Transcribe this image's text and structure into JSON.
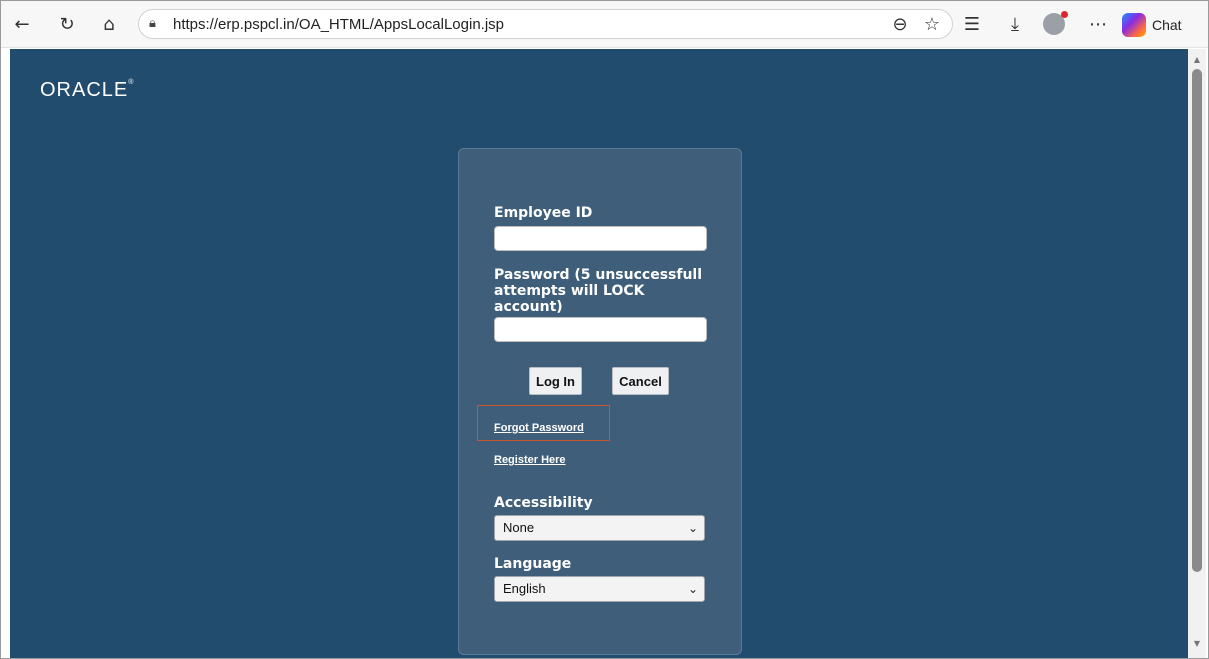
{
  "browser": {
    "url": "https://erp.pspcl.in/OA_HTML/AppsLocalLogin.jsp",
    "chat_label": "Chat",
    "icons": [
      "back-icon",
      "refresh-icon",
      "home-icon",
      "site-info-icon",
      "zoom-out-icon",
      "favorite-star-icon",
      "favorites-list-icon",
      "download-icon",
      "profile-icon",
      "more-icon",
      "copilot-icon"
    ]
  },
  "page": {
    "logo": "ORACLE",
    "form": {
      "employee_id_label": "Employee ID",
      "password_label": "Password (5 unsuccessfull attempts will LOCK account)",
      "login_button": "Log In",
      "cancel_button": "Cancel",
      "forgot_password": "Forgot Password",
      "register_here": "Register Here",
      "accessibility_label": "Accessibility",
      "accessibility_value": "None",
      "language_label": "Language",
      "language_value": "English"
    }
  },
  "colors": {
    "page_bg": "#214c6d",
    "panel_bg": "#3f5e79",
    "highlight": "#c8572c"
  }
}
